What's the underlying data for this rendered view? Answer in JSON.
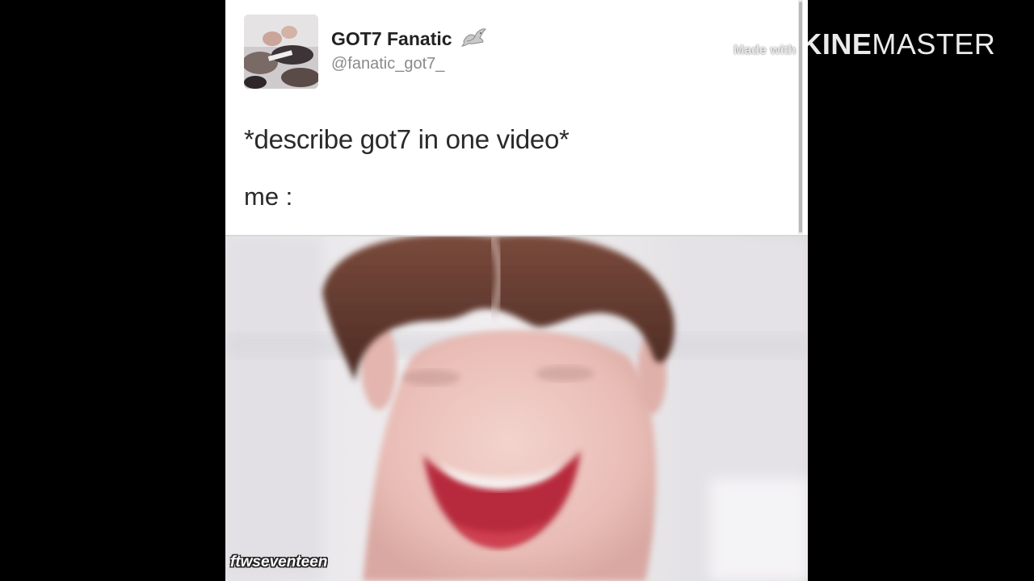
{
  "tweet": {
    "display_name": "GOT7 Fanatic",
    "handle": "@fanatic_got7_",
    "text": "*describe got7 in one video*",
    "me_line": "me :",
    "avatar_icon": "avatar-photo",
    "badge_icon": "dove-icon"
  },
  "media": {
    "credit": "ftwseventeen"
  },
  "watermark": {
    "made_with": "Made with",
    "brand_bold": "KINE",
    "brand_light": "MASTER"
  },
  "colors": {
    "background": "#000000",
    "card": "#ffffff",
    "text": "#2a2a2a",
    "handle": "#8a8a8a"
  }
}
